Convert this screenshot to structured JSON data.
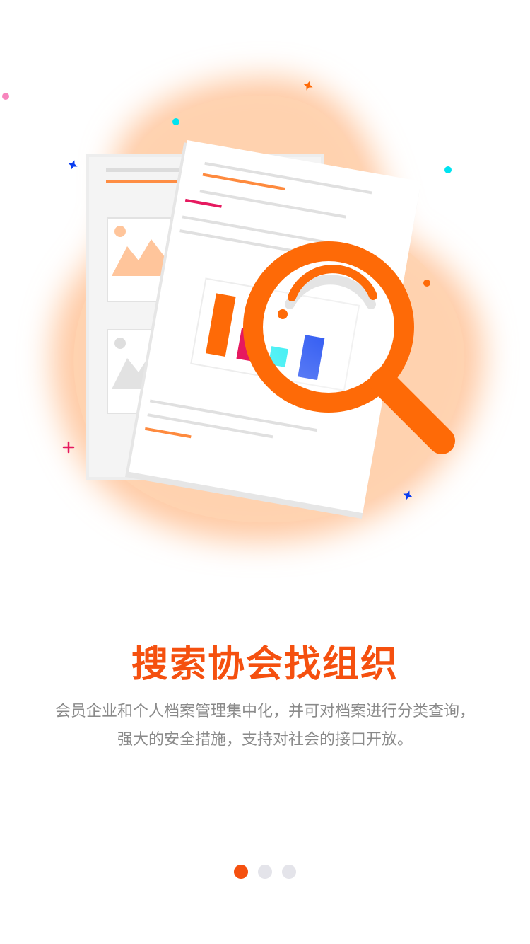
{
  "onboarding": {
    "title": "搜索协会找组织",
    "description": "会员企业和个人档案管理集中化，并可对档案进行分类查询，强大的安全措施，支持对社会的接口开放。",
    "illustration_icon": "document-search-magnifier-icon",
    "pager": {
      "total": 3,
      "active_index": 0
    }
  },
  "colors": {
    "accent": "#f5500f",
    "magnifier": "#fe6a07",
    "blob": "#ffc59b",
    "text_secondary": "#8a8a8a",
    "dot_inactive": "#e4e4ea"
  }
}
